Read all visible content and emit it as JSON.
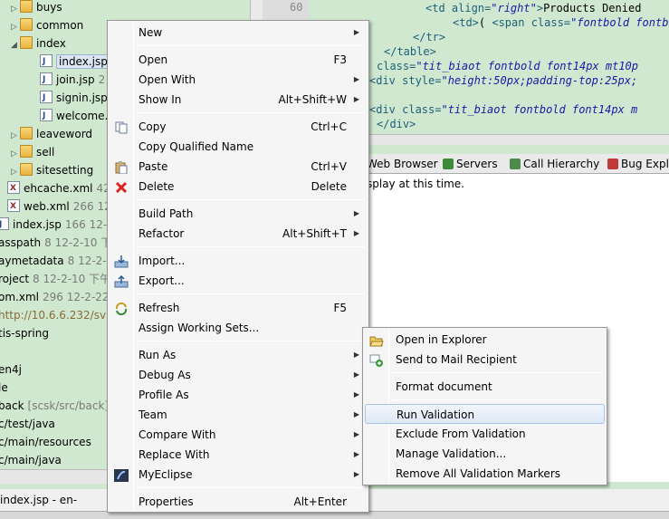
{
  "explorer": {
    "rows": [
      {
        "label": "buys",
        "meta": ""
      },
      {
        "label": "common",
        "meta": ""
      },
      {
        "label": "index",
        "meta": ""
      },
      {
        "label": "index.jsp",
        "meta": ""
      },
      {
        "label": "join.jsp",
        "meta": "2"
      },
      {
        "label": "signin.jsp",
        "meta": ""
      },
      {
        "label": "welcome.",
        "meta": ""
      },
      {
        "label": "leaveword",
        "meta": ""
      },
      {
        "label": "sell",
        "meta": ""
      },
      {
        "label": "sitesetting",
        "meta": ""
      },
      {
        "label": "ehcache.xml",
        "meta": "424"
      },
      {
        "label": "web.xml",
        "meta": "266  12"
      },
      {
        "label": "index.jsp",
        "meta": "166  12-2"
      },
      {
        "label": "asspath",
        "meta": "8  12-2-10  下"
      },
      {
        "label": "aymetadata",
        "meta": "8  12-2-1"
      },
      {
        "label": "roject",
        "meta": "8  12-2-10  下午"
      },
      {
        "label": "om.xml",
        "meta": "296  12-2-22"
      },
      {
        "label": "http://10.6.6.232/svn/",
        "meta": ""
      },
      {
        "label": "tis-spring",
        "meta": ""
      },
      {
        "label": "",
        "meta": ""
      },
      {
        "label": "en4j",
        "meta": ""
      },
      {
        "label": "le",
        "meta": ""
      },
      {
        "label": "back",
        "meta": "[scsk/src/back]"
      },
      {
        "label": "c/test/java",
        "meta": ""
      },
      {
        "label": "c/main/resources",
        "meta": ""
      },
      {
        "label": "c/main/java",
        "meta": ""
      }
    ]
  },
  "status_left": "index.jsp - en-work/W",
  "editor": {
    "line_number": "60",
    "lines": [
      [
        {
          "c": "tag",
          "t": "<td align="
        },
        {
          "c": "str",
          "t": "\"right\""
        },
        {
          "c": "tag",
          "t": ">"
        },
        {
          "c": "txt",
          "t": "Products Denied"
        }
      ],
      [
        {
          "c": "tag",
          "t": "<td>"
        },
        {
          "c": "txt",
          "t": "( "
        },
        {
          "c": "tag",
          "t": "<span class="
        },
        {
          "c": "str",
          "t": "\"fontbold fontb"
        }
      ],
      [
        {
          "c": "tag",
          "t": "</tr>"
        }
      ],
      [
        {
          "c": "tag",
          "t": "</table>"
        }
      ],
      [
        {
          "c": "tag",
          "t": "class="
        },
        {
          "c": "str",
          "t": "\"tit_biaot fontbold font14px mt10p"
        }
      ],
      [
        {
          "c": "tag",
          "t": "<div style="
        },
        {
          "c": "str",
          "t": "\"height:50px;padding-top:25px;"
        }
      ],
      [
        {
          "c": "txt",
          "t": ""
        }
      ],
      [
        {
          "c": "tag",
          "t": "<div class="
        },
        {
          "c": "str",
          "t": "\"tit_biaot fontbold font14px m"
        }
      ],
      [
        {
          "c": "tag",
          "t": "</div>"
        }
      ]
    ]
  },
  "view_tabs": [
    "Web Browser",
    "Servers",
    "Call Hierarchy",
    "Bug Expl"
  ],
  "view_message": "splay at this time.",
  "menu1": {
    "items": [
      {
        "label": "New",
        "shortcut": "",
        "submenu": true,
        "icon": ""
      },
      {
        "sep": true
      },
      {
        "label": "Open",
        "shortcut": "F3",
        "submenu": false,
        "icon": ""
      },
      {
        "label": "Open With",
        "shortcut": "",
        "submenu": true,
        "icon": ""
      },
      {
        "label": "Show In",
        "shortcut": "Alt+Shift+W",
        "submenu": true,
        "icon": ""
      },
      {
        "sep": true
      },
      {
        "label": "Copy",
        "shortcut": "Ctrl+C",
        "submenu": false,
        "icon": "copy-icon"
      },
      {
        "label": "Copy Qualified Name",
        "shortcut": "",
        "submenu": false,
        "icon": ""
      },
      {
        "label": "Paste",
        "shortcut": "Ctrl+V",
        "submenu": false,
        "icon": "paste-icon"
      },
      {
        "label": "Delete",
        "shortcut": "Delete",
        "submenu": false,
        "icon": "delete-icon"
      },
      {
        "sep": true
      },
      {
        "label": "Build Path",
        "shortcut": "",
        "submenu": true,
        "icon": ""
      },
      {
        "label": "Refactor",
        "shortcut": "Alt+Shift+T",
        "submenu": true,
        "icon": ""
      },
      {
        "sep": true
      },
      {
        "label": "Import...",
        "shortcut": "",
        "submenu": false,
        "icon": "import-icon"
      },
      {
        "label": "Export...",
        "shortcut": "",
        "submenu": false,
        "icon": "export-icon"
      },
      {
        "sep": true
      },
      {
        "label": "Refresh",
        "shortcut": "F5",
        "submenu": false,
        "icon": "refresh-icon"
      },
      {
        "label": "Assign Working Sets...",
        "shortcut": "",
        "submenu": false,
        "icon": ""
      },
      {
        "sep": true
      },
      {
        "label": "Run As",
        "shortcut": "",
        "submenu": true,
        "icon": ""
      },
      {
        "label": "Debug As",
        "shortcut": "",
        "submenu": true,
        "icon": ""
      },
      {
        "label": "Profile As",
        "shortcut": "",
        "submenu": true,
        "icon": ""
      },
      {
        "label": "Team",
        "shortcut": "",
        "submenu": true,
        "icon": ""
      },
      {
        "label": "Compare With",
        "shortcut": "",
        "submenu": true,
        "icon": ""
      },
      {
        "label": "Replace With",
        "shortcut": "",
        "submenu": true,
        "icon": ""
      },
      {
        "label": "MyEclipse",
        "shortcut": "",
        "submenu": true,
        "icon": "myeclipse-icon"
      },
      {
        "sep": true
      },
      {
        "label": "Properties",
        "shortcut": "Alt+Enter",
        "submenu": false,
        "icon": ""
      }
    ]
  },
  "menu2": {
    "items": [
      {
        "label": "Open in Explorer",
        "icon": "folder-open-icon"
      },
      {
        "label": "Send to Mail Recipient",
        "icon": "mail-icon"
      },
      {
        "sep": true
      },
      {
        "label": "Format document",
        "icon": ""
      },
      {
        "sep": true
      },
      {
        "label": "Run Validation",
        "icon": ""
      },
      {
        "label": "Exclude From Validation",
        "icon": ""
      },
      {
        "label": "Manage Validation...",
        "icon": ""
      },
      {
        "label": "Remove All Validation Markers",
        "icon": ""
      }
    ]
  }
}
